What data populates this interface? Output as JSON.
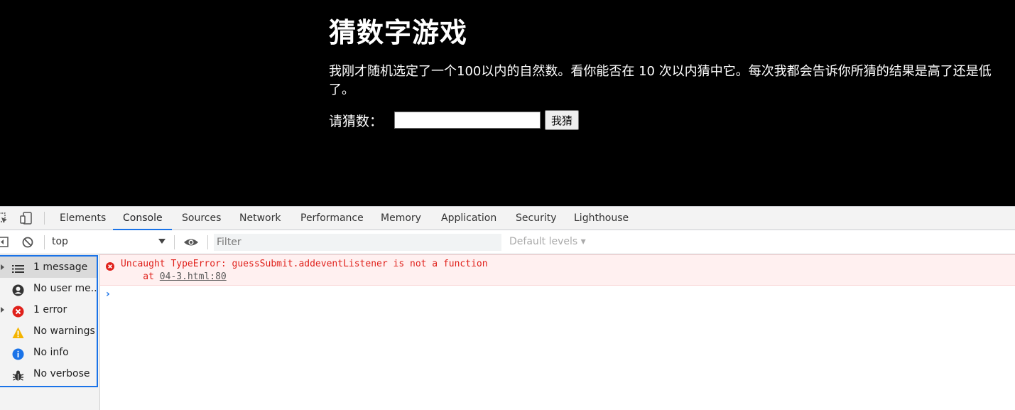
{
  "page": {
    "title": "猜数字游戏",
    "intro": "我刚才随机选定了一个100以内的自然数。看你能否在 10 次以内猜中它。每次我都会告诉你所猜的结果是高了还是低了。",
    "guess_label": "请猜数：",
    "guess_value": "",
    "submit_label": "我猜"
  },
  "devtools": {
    "tabs": [
      "Elements",
      "Console",
      "Sources",
      "Network",
      "Performance",
      "Memory",
      "Application",
      "Security",
      "Lighthouse"
    ],
    "active_tab": "Console",
    "toolbar": {
      "context": "top",
      "filter_placeholder": "Filter",
      "levels": "Default levels ▾"
    },
    "sidebar": {
      "items": [
        {
          "label": "1 message",
          "icon": "list-icon"
        },
        {
          "label": "No user me...",
          "icon": "user-icon"
        },
        {
          "label": "1 error",
          "icon": "error-icon"
        },
        {
          "label": "No warnings",
          "icon": "warning-icon"
        },
        {
          "label": "No info",
          "icon": "info-icon"
        },
        {
          "label": "No verbose",
          "icon": "bug-icon"
        }
      ]
    },
    "console": {
      "error_message": "Uncaught TypeError: guessSubmit.addeventListener is not a function",
      "error_at_prefix": "    at ",
      "error_location": "04-3.html:80",
      "prompt": "›"
    }
  },
  "colors": {
    "accent": "#1a73e8",
    "error": "#e0211b",
    "error_bg": "#fff0f0",
    "warning": "#f4b400",
    "info": "#1a73e8"
  }
}
